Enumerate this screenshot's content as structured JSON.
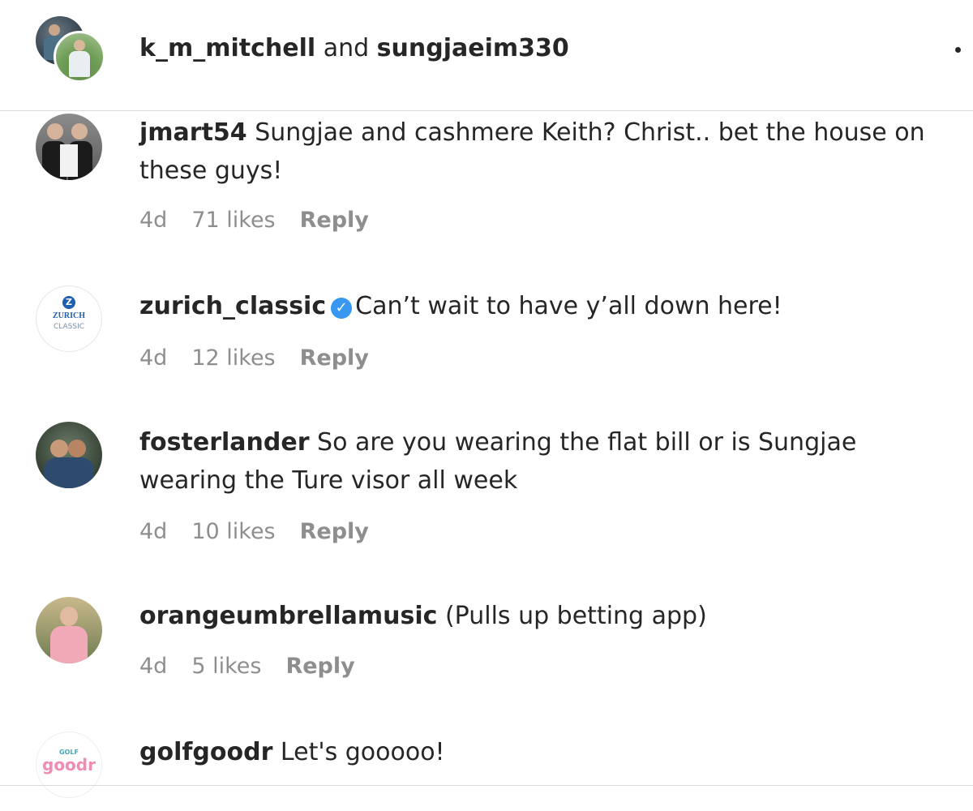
{
  "header": {
    "user_a": "k_m_mitchell",
    "connector": " and ",
    "user_b": "sungjaeim330"
  },
  "comments": [
    {
      "username": "jmart54",
      "text": " Sungjae and cashmere Keith? Christ.. bet the house on these guys!",
      "time": "4d",
      "likes": "71 likes",
      "reply": "Reply",
      "verified": false
    },
    {
      "username": "zurich_classic",
      "text": "Can’t wait to have y’all down here!",
      "time": "4d",
      "likes": "12 likes",
      "reply": "Reply",
      "verified": true,
      "avatar_text": "ZURICH",
      "avatar_subtext": "CLASSIC"
    },
    {
      "username": "fosterlander",
      "text": " So are you wearing the flat bill or is Sungjae wearing the Ture visor all week",
      "time": "4d",
      "likes": "10 likes",
      "reply": "Reply",
      "verified": false
    },
    {
      "username": "orangeumbrellamusic",
      "text": " (Pulls up betting app)",
      "time": "4d",
      "likes": "5 likes",
      "reply": "Reply",
      "verified": false
    },
    {
      "username": "golfgoodr",
      "text": " Let's gooooo!",
      "verified": false,
      "avatar_text": "goodr",
      "avatar_small": "GOLF"
    }
  ],
  "colors": {
    "text": "#262626",
    "meta": "#8e8e8e",
    "verified": "#3897f0",
    "divider": "#dbdbdb"
  },
  "icons": {
    "more": "more-options-icon",
    "verified": "verified-badge-icon"
  }
}
